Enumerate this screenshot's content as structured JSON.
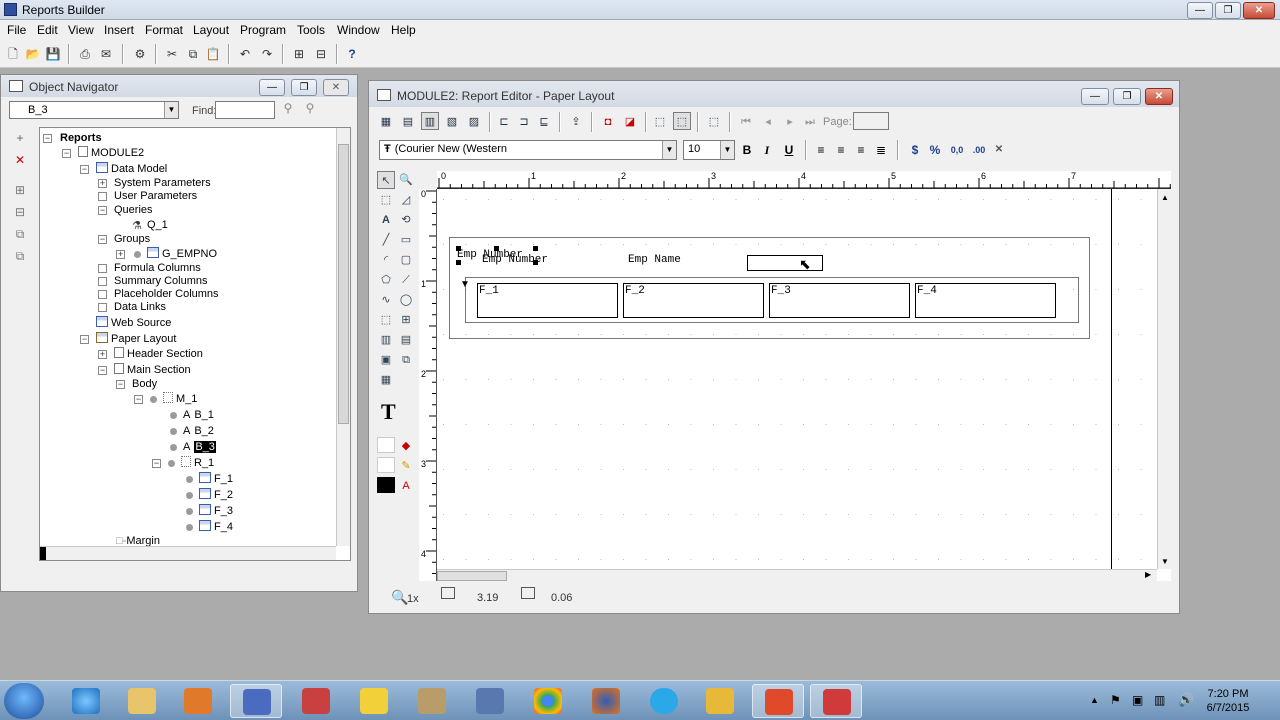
{
  "app": {
    "title": "Reports Builder"
  },
  "menu": [
    "File",
    "Edit",
    "View",
    "Insert",
    "Format",
    "Layout",
    "Program",
    "Tools",
    "Window",
    "Help"
  ],
  "navigator": {
    "title": "Object Navigator",
    "selected_object": "B_3",
    "find_label": "Find:",
    "find_value": "",
    "tree": [
      {
        "label": "Reports"
      },
      {
        "label": "MODULE2"
      },
      {
        "label": "Data Model"
      },
      {
        "label": "System Parameters"
      },
      {
        "label": "User Parameters"
      },
      {
        "label": "Queries"
      },
      {
        "label": "Q_1"
      },
      {
        "label": "Groups"
      },
      {
        "label": "G_EMPNO"
      },
      {
        "label": "Formula Columns"
      },
      {
        "label": "Summary Columns"
      },
      {
        "label": "Placeholder Columns"
      },
      {
        "label": "Data Links"
      },
      {
        "label": "Web Source"
      },
      {
        "label": "Paper Layout"
      },
      {
        "label": "Header Section"
      },
      {
        "label": "Main Section"
      },
      {
        "label": "Body"
      },
      {
        "label": "M_1"
      },
      {
        "label": "B_1"
      },
      {
        "label": "B_2"
      },
      {
        "label": "B_3"
      },
      {
        "label": "R_1"
      },
      {
        "label": "F_1"
      },
      {
        "label": "F_2"
      },
      {
        "label": "F_3"
      },
      {
        "label": "F_4"
      },
      {
        "label": "Margin"
      }
    ]
  },
  "editor": {
    "title": "MODULE2: Report Editor - Paper Layout",
    "page_label": "Page:",
    "page_value": "",
    "font": "(Courier New (Western",
    "font_size": "10",
    "ruler_h": [
      "0",
      "1",
      "2",
      "3",
      "4",
      "5",
      "6",
      "7"
    ],
    "ruler_v": [
      "0",
      "1",
      "2",
      "3",
      "4"
    ],
    "layout": {
      "boilerplate": [
        "Emp Number",
        "Emp Number",
        "Emp Name"
      ],
      "fields": [
        "F_1",
        "F_2",
        "F_3",
        "F_4"
      ]
    },
    "status": {
      "zoom": "1x",
      "x": "3.19",
      "y": "0.06"
    }
  },
  "clock": {
    "time": "7:20 PM",
    "date": "6/7/2015"
  },
  "colors": {
    "selection": "#000000",
    "title_bar": "#d3dae4",
    "desktop": "#ababab"
  }
}
